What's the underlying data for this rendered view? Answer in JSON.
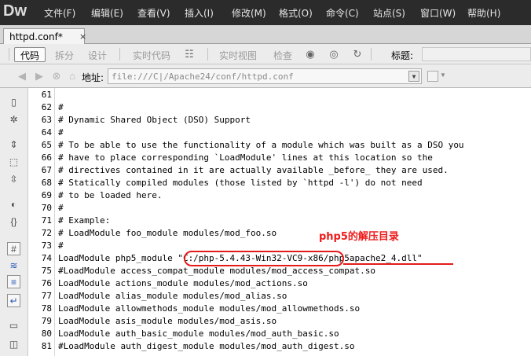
{
  "app": {
    "logo": "Dw"
  },
  "menu": [
    {
      "label": "文件(F)"
    },
    {
      "label": "编辑(E)"
    },
    {
      "label": "查看(V)"
    },
    {
      "label": "插入(I)"
    },
    {
      "label": "修改(M)"
    },
    {
      "label": "格式(O)"
    },
    {
      "label": "命令(C)"
    },
    {
      "label": "站点(S)"
    },
    {
      "label": "窗口(W)"
    },
    {
      "label": "帮助(H)"
    }
  ],
  "doc_tab": {
    "name": "httpd.conf*",
    "close": "×"
  },
  "view_toolbar": {
    "code": "代码",
    "split": "拆分",
    "design": "设计",
    "live_code": "实时代码",
    "live_view": "实时视图",
    "inspect": "检查",
    "title_label": "标题:"
  },
  "address_bar": {
    "label": "地址:",
    "value": "file:///C|/Apache24/conf/httpd.conf"
  },
  "editor": {
    "lines": [
      {
        "n": "61",
        "text": ""
      },
      {
        "n": "62",
        "text": "#"
      },
      {
        "n": "63",
        "text": "# Dynamic Shared Object (DSO) Support"
      },
      {
        "n": "64",
        "text": "#"
      },
      {
        "n": "65",
        "text": "# To be able to use the functionality of a module which was built as a DSO you"
      },
      {
        "n": "66",
        "text": "# have to place corresponding `LoadModule' lines at this location so the"
      },
      {
        "n": "67",
        "text": "# directives contained in it are actually available _before_ they are used."
      },
      {
        "n": "68",
        "text": "# Statically compiled modules (those listed by `httpd -l') do not need"
      },
      {
        "n": "69",
        "text": "# to be loaded here."
      },
      {
        "n": "70",
        "text": "#"
      },
      {
        "n": "71",
        "text": "# Example:"
      },
      {
        "n": "72",
        "text": "# LoadModule foo_module modules/mod_foo.so"
      },
      {
        "n": "73",
        "text": "#"
      },
      {
        "n": "74",
        "text": "LoadModule php5_module \"C:/php-5.4.43-Win32-VC9-x86/php5apache2_4.dll\""
      },
      {
        "n": "75",
        "text": "#LoadModule access_compat_module modules/mod_access_compat.so"
      },
      {
        "n": "76",
        "text": "LoadModule actions_module modules/mod_actions.so"
      },
      {
        "n": "77",
        "text": "LoadModule alias_module modules/mod_alias.so"
      },
      {
        "n": "78",
        "text": "LoadModule allowmethods_module modules/mod_allowmethods.so"
      },
      {
        "n": "79",
        "text": "LoadModule asis_module modules/mod_asis.so"
      },
      {
        "n": "80",
        "text": "LoadModule auth_basic_module modules/mod_auth_basic.so"
      },
      {
        "n": "81",
        "text": "#LoadModule auth_digest_module modules/mod_auth_digest.so"
      }
    ]
  },
  "annotation": {
    "text": "php5的解压目录",
    "color": "#ee1b1b"
  },
  "colors": {
    "menubar": "#2b2b2b",
    "annotation": "#e41b1b"
  }
}
